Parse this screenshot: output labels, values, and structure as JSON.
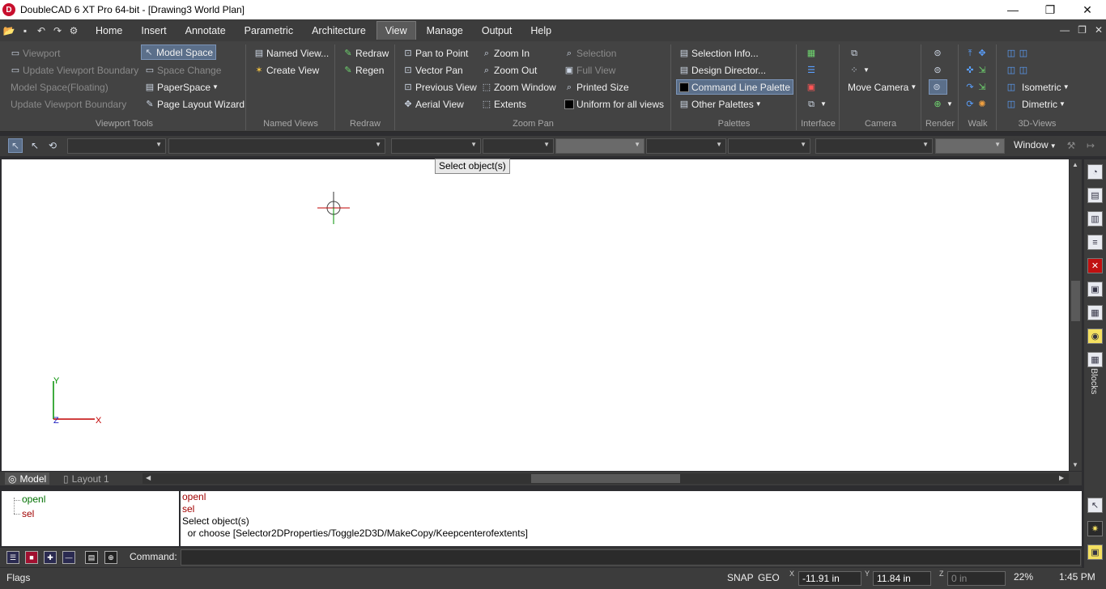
{
  "window": {
    "title": "DoubleCAD 6 XT Pro 64-bit - [Drawing3 World Plan]",
    "logo_letter": "D",
    "minimize": "—",
    "restore": "❐",
    "close": "✕"
  },
  "menu": {
    "items": [
      "Home",
      "Insert",
      "Annotate",
      "Parametric",
      "Architecture",
      "View",
      "Manage",
      "Output",
      "Help"
    ],
    "active": "View"
  },
  "ribbon": {
    "viewport_tools": {
      "label": "Viewport Tools",
      "viewport": "Viewport",
      "update_viewport_boundary_1": "Update Viewport Boundary",
      "model_space_floating": "Model Space(Floating)",
      "update_viewport_boundary_2": "Update Viewport Boundary",
      "model_space": "Model Space",
      "space_change": "Space Change",
      "paperspace": "PaperSpace",
      "page_layout_wizard": "Page Layout Wizard"
    },
    "named_views": {
      "label": "Named Views",
      "named_view": "Named View...",
      "create_view": "Create View"
    },
    "redraw": {
      "label": "Redraw",
      "redraw": "Redraw",
      "regen": "Regen"
    },
    "zoom_pan": {
      "label": "Zoom Pan",
      "pan_to_point": "Pan to Point",
      "vector_pan": "Vector Pan",
      "previous_view": "Previous View",
      "aerial_view": "Aerial View",
      "zoom_in": "Zoom In",
      "zoom_out": "Zoom Out",
      "zoom_window": "Zoom Window",
      "extents": "Extents",
      "selection": "Selection",
      "full_view": "Full View",
      "printed_size": "Printed Size",
      "uniform_for_all_views": "Uniform for all views"
    },
    "palettes": {
      "label": "Palettes",
      "selection_info": "Selection Info...",
      "design_director": "Design Director...",
      "command_line_palette": "Command Line Palette",
      "other_palettes": "Other Palettes"
    },
    "interface": {
      "label": "Interface"
    },
    "camera": {
      "label": "Camera",
      "move_camera": "Move Camera"
    },
    "render": {
      "label": "Render"
    },
    "walk": {
      "label": "Walk"
    },
    "views3d": {
      "label": "3D-Views",
      "isometric": "Isometric",
      "dimetric": "Dimetric"
    }
  },
  "toolbar": {
    "window_dropdown": "Window"
  },
  "tooltip": "Select object(s)",
  "canvas": {
    "axis_y": "Y",
    "axis_x": "X",
    "axis_z": "Z"
  },
  "tabs": [
    {
      "label": "Model",
      "active": true
    },
    {
      "label": "Layout 1",
      "active": false
    }
  ],
  "palette_strip": {
    "blocks_label": "Blocks"
  },
  "command": {
    "tree": [
      "openl",
      "sel"
    ],
    "history": [
      {
        "text": "openl",
        "color": "red"
      },
      {
        "text": "sel",
        "color": "red"
      },
      {
        "text": "Select object(s)",
        "color": "black"
      },
      {
        "text": "  or choose [Selector2DProperties/Toggle2D3D/MakeCopy/Keepcenterofextents]",
        "color": "black"
      }
    ],
    "label": "Command:",
    "input_value": ""
  },
  "status": {
    "flags": "Flags",
    "snap": "SNAP",
    "geo": "GEO",
    "x_label": "X",
    "y_label": "Y",
    "z_label": "Z",
    "x_value": "-11.91 in",
    "y_value": "11.84 in",
    "z_value": "0 in",
    "zoom": "22%",
    "time": "1:45 PM"
  },
  "colors": {
    "chrome_bg": "#3c3c3c",
    "ribbon_bg": "#434343",
    "selected_bg": "#5b6f8a",
    "canvas_bg": "#ffffff",
    "history_red": "#a00000",
    "tree_green": "#007000"
  }
}
